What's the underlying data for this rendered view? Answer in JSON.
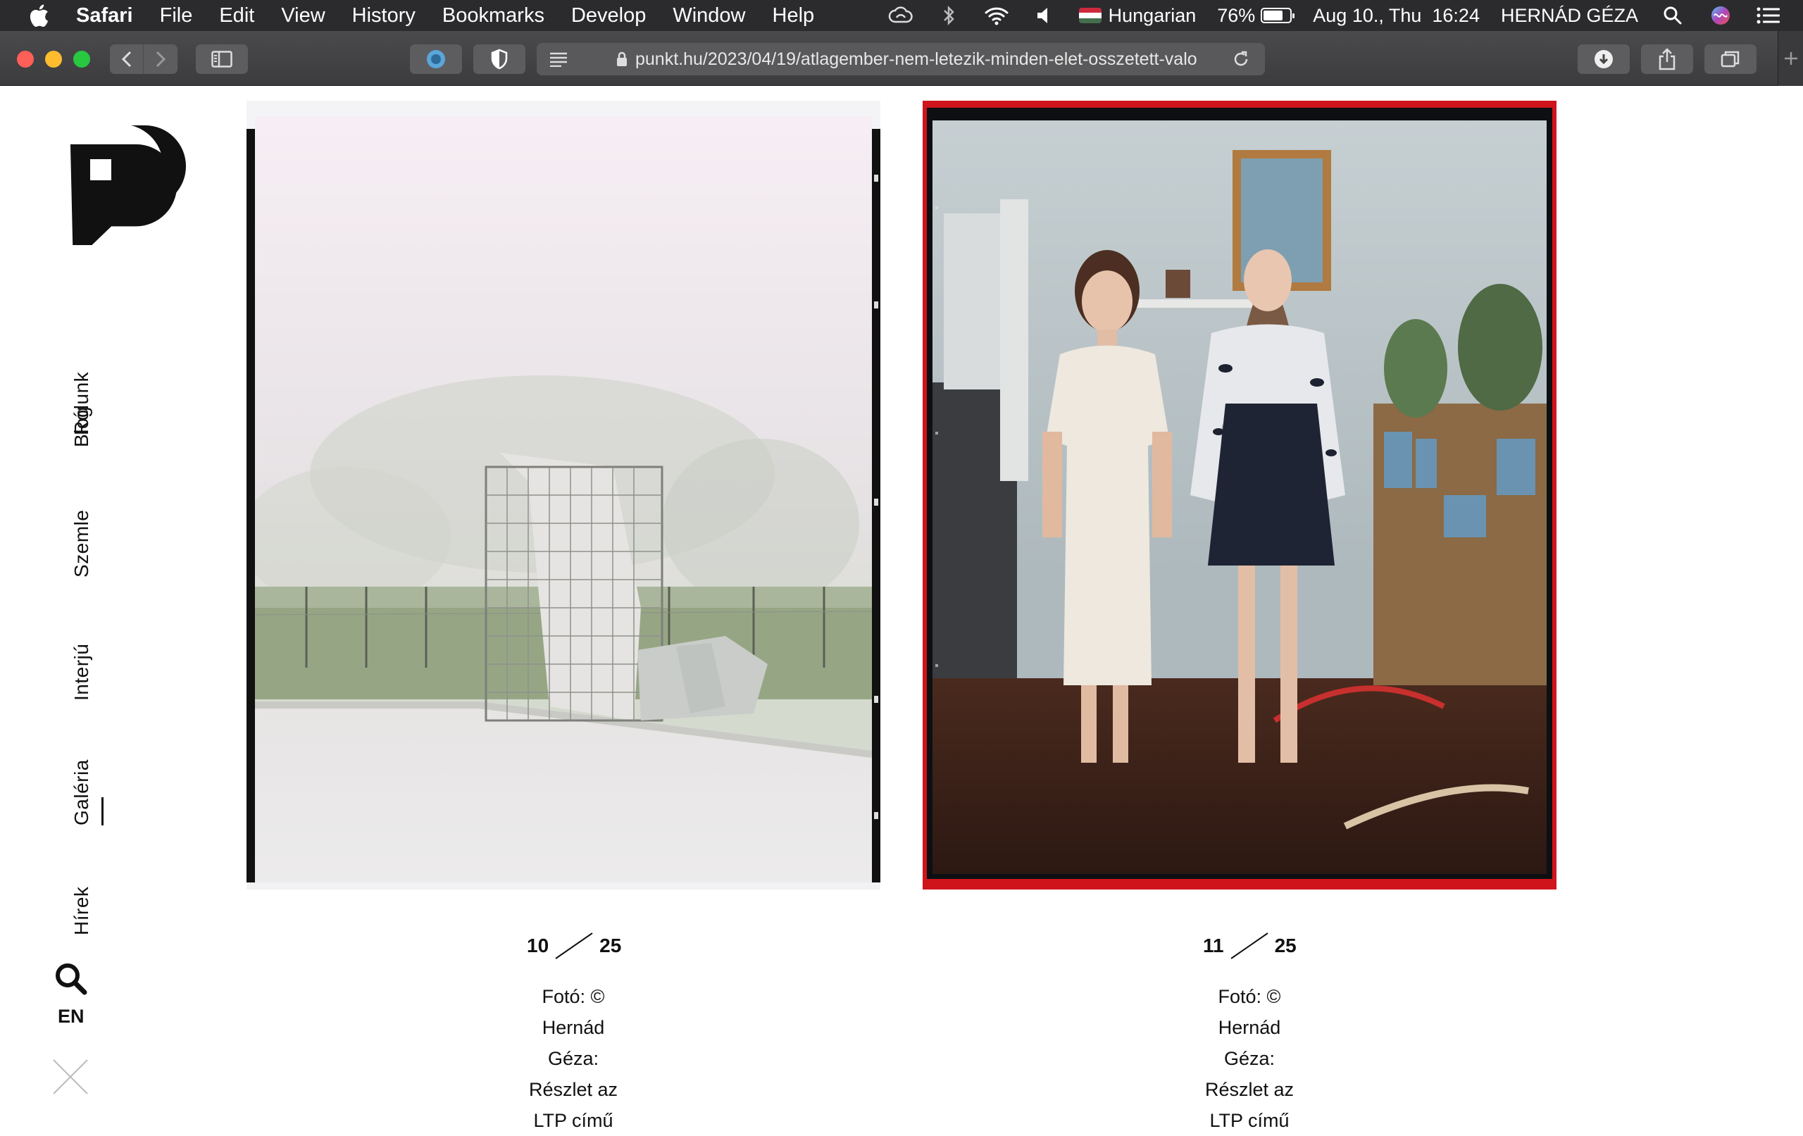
{
  "menubar": {
    "app": "Safari",
    "menus": [
      "File",
      "Edit",
      "View",
      "History",
      "Bookmarks",
      "Develop",
      "Window",
      "Help"
    ],
    "input_source": "Hungarian",
    "battery": "76%",
    "battery_level": 0.76,
    "datetime": "Aug 10., Thu  16:24",
    "user": "HERNÁD GÉZA"
  },
  "browser": {
    "url": "punkt.hu/2023/04/19/atlagember-nem-letezik-minden-elet-osszetett-valo"
  },
  "sidebar": {
    "nav": [
      {
        "label": "Rólunk"
      },
      {
        "label": "Blog"
      },
      {
        "label": "Szemle"
      },
      {
        "label": "Interjú"
      },
      {
        "label": "Galéria"
      },
      {
        "label": "Hírek"
      }
    ],
    "active": "Galéria",
    "lang": "EN"
  },
  "gallery": [
    {
      "index": "10",
      "total": "25",
      "caption": [
        "Fotó: ©",
        "Hernád",
        "Géza:",
        "Részlet az",
        "LTP című"
      ]
    },
    {
      "index": "11",
      "total": "25",
      "caption": [
        "Fotó: ©",
        "Hernád",
        "Géza:",
        "Részlet az",
        "LTP című"
      ]
    }
  ]
}
